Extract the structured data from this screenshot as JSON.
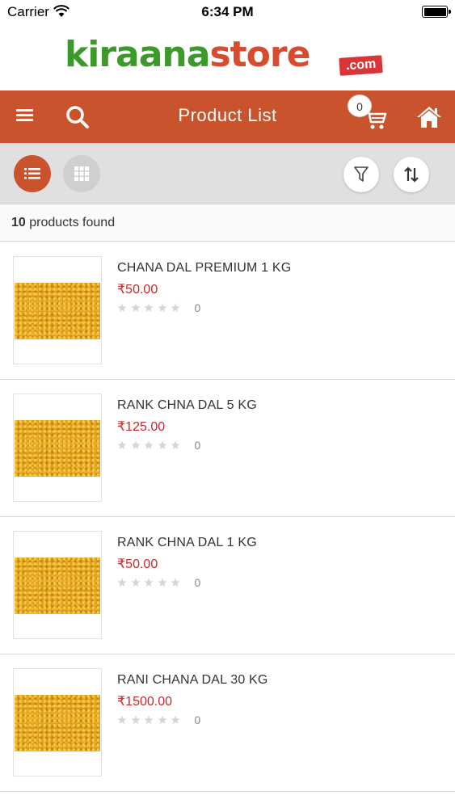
{
  "status_bar": {
    "carrier": "Carrier",
    "time": "6:34 PM"
  },
  "logo": {
    "part1": "kiraana",
    "part2": "store",
    "part3": ".com"
  },
  "header": {
    "title": "Product List",
    "cart_count": "0"
  },
  "results": {
    "count": "10",
    "label": " products found"
  },
  "colors": {
    "accent": "#c9532c",
    "price": "#c62828"
  },
  "products": [
    {
      "name": "CHANA DAL PREMIUM 1 KG",
      "price": "₹50.00",
      "rating_count": "0",
      "rating": 0
    },
    {
      "name": "RANK CHNA DAL 5 KG",
      "price": "₹125.00",
      "rating_count": "0",
      "rating": 0
    },
    {
      "name": "RANK CHNA DAL 1 KG",
      "price": "₹50.00",
      "rating_count": "0",
      "rating": 0
    },
    {
      "name": "RANI CHANA DAL 30 KG",
      "price": "₹1500.00",
      "rating_count": "0",
      "rating": 0
    }
  ]
}
